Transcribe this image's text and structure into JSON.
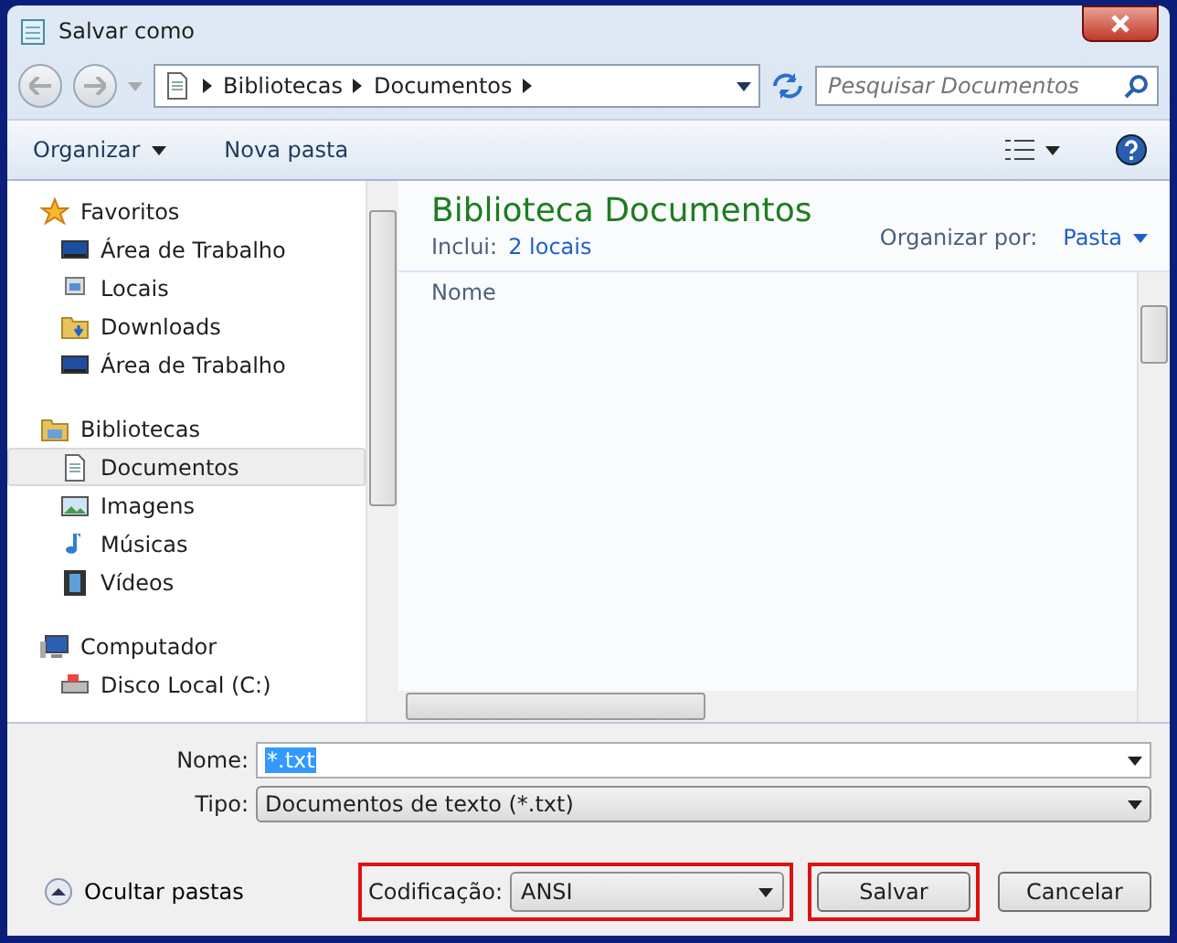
{
  "window": {
    "title": "Salvar como"
  },
  "address": {
    "crumbs": [
      "Bibliotecas",
      "Documentos"
    ]
  },
  "search": {
    "placeholder": "Pesquisar Documentos"
  },
  "toolbar": {
    "organize": "Organizar",
    "new_folder": "Nova pasta"
  },
  "sidebar": {
    "sections": [
      {
        "label": "Favoritos",
        "kind": "star",
        "children": [
          {
            "label": "Área de Trabalho",
            "kind": "desktop",
            "selected": false
          },
          {
            "label": "Locais",
            "kind": "places",
            "selected": false
          },
          {
            "label": "Downloads",
            "kind": "downloads",
            "selected": false
          },
          {
            "label": "Área de Trabalho",
            "kind": "desktop",
            "selected": false
          }
        ]
      },
      {
        "label": "Bibliotecas",
        "kind": "library",
        "children": [
          {
            "label": "Documentos",
            "kind": "document",
            "selected": true
          },
          {
            "label": "Imagens",
            "kind": "image",
            "selected": false
          },
          {
            "label": "Músicas",
            "kind": "music",
            "selected": false
          },
          {
            "label": "Vídeos",
            "kind": "video",
            "selected": false
          }
        ]
      },
      {
        "label": "Computador",
        "kind": "computer",
        "children": [
          {
            "label": "Disco Local (C:)",
            "kind": "drive",
            "selected": false
          }
        ]
      }
    ]
  },
  "library": {
    "title": "Biblioteca Documentos",
    "includes_label": "Inclui:",
    "includes_link": "2 locais",
    "arrange_label": "Organizar por:",
    "arrange_value": "Pasta"
  },
  "table": {
    "columns": [
      "Nome"
    ]
  },
  "form": {
    "name_label": "Nome:",
    "name_value": "*.txt",
    "type_label": "Tipo:",
    "type_value": "Documentos de texto (*.txt)"
  },
  "footer": {
    "hide_folders": "Ocultar pastas",
    "encoding_label": "Codificação:",
    "encoding_value": "ANSI",
    "encoding_highlighted": true,
    "save": "Salvar",
    "save_highlighted": true,
    "cancel": "Cancelar"
  }
}
